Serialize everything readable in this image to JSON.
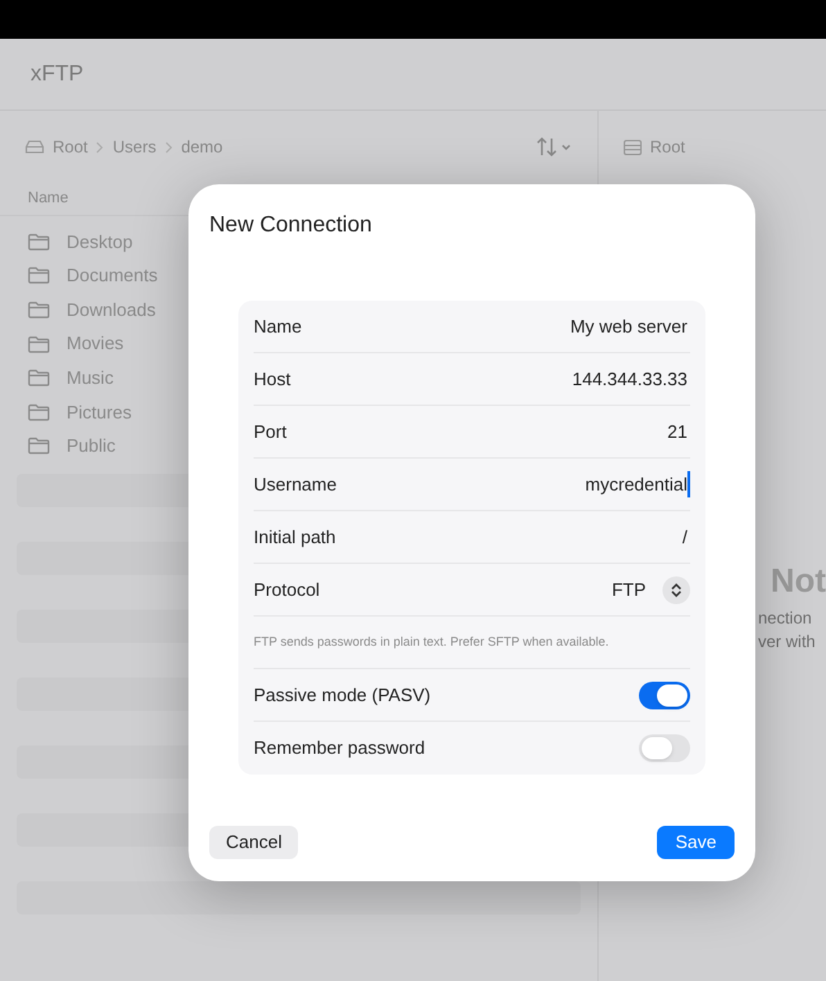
{
  "app": {
    "title": "xFTP"
  },
  "left_pane": {
    "breadcrumb": [
      "Root",
      "Users",
      "demo"
    ],
    "column_header": "Name",
    "items": [
      {
        "name": "Desktop"
      },
      {
        "name": "Documents"
      },
      {
        "name": "Downloads"
      },
      {
        "name": "Movies"
      },
      {
        "name": "Music"
      },
      {
        "name": "Pictures"
      },
      {
        "name": "Public"
      }
    ]
  },
  "right_pane": {
    "location": "Root",
    "empty_title": "Not",
    "empty_lines": [
      "nection",
      "ver with"
    ]
  },
  "dialog": {
    "title": "New Connection",
    "fields": [
      {
        "kind": "text",
        "label": "Name",
        "value": "My web server",
        "focused": false
      },
      {
        "kind": "text",
        "label": "Host",
        "value": "144.344.33.33",
        "focused": false
      },
      {
        "kind": "text",
        "label": "Port",
        "value": "21",
        "focused": false
      },
      {
        "kind": "text",
        "label": "Username",
        "value": "mycredential",
        "focused": true
      },
      {
        "kind": "text",
        "label": "Initial path",
        "value": "/",
        "focused": false
      },
      {
        "kind": "select",
        "label": "Protocol",
        "value": "FTP"
      },
      {
        "kind": "note",
        "text": "FTP sends passwords in plain text. Prefer SFTP when available."
      },
      {
        "kind": "toggle",
        "label": "Passive mode (PASV)",
        "on": true
      },
      {
        "kind": "toggle",
        "label": "Remember password",
        "on": false
      }
    ],
    "buttons": {
      "cancel": "Cancel",
      "save": "Save"
    }
  }
}
